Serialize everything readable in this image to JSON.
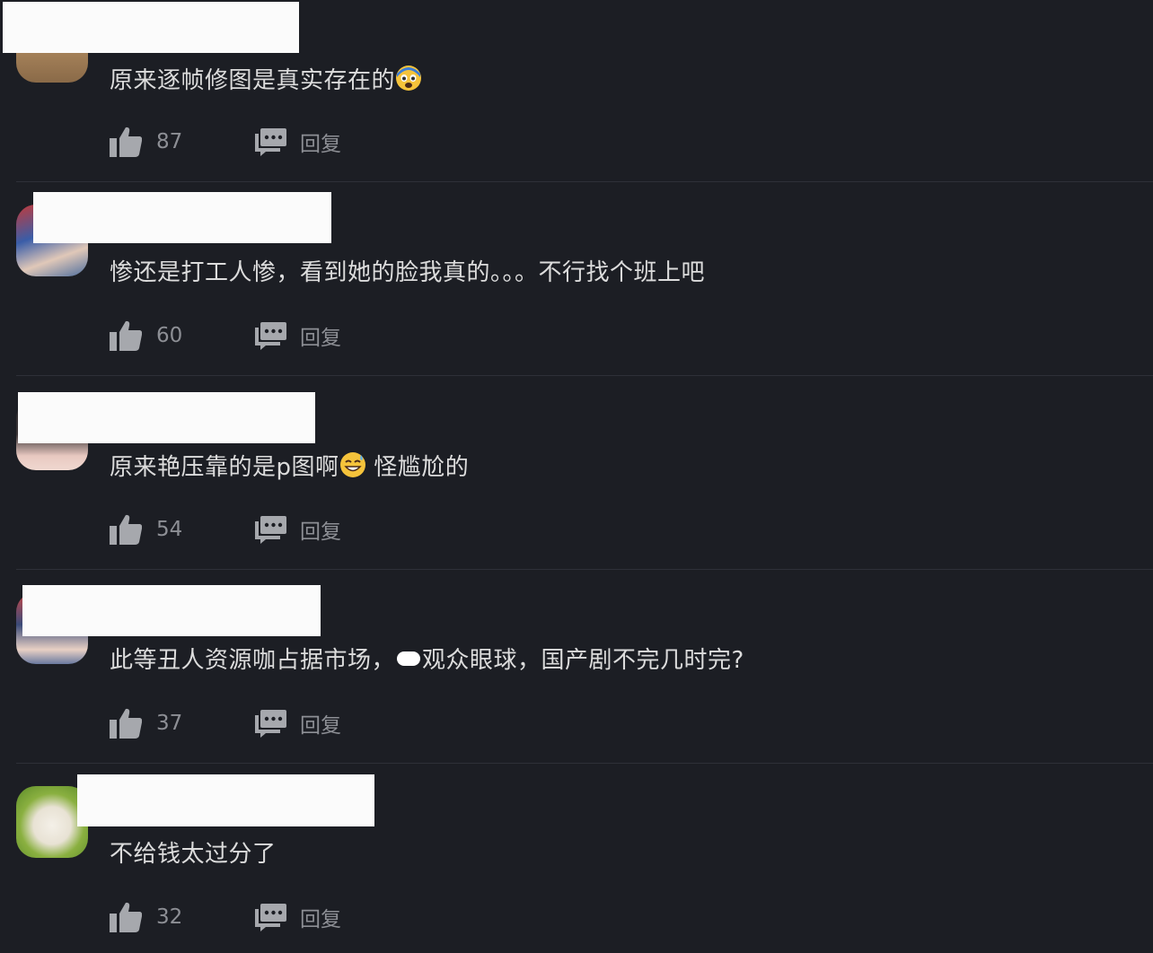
{
  "comments": [
    {
      "text": "原来逐帧修图是真实存在的",
      "emoji": "fearful-face",
      "likes": "87",
      "reply_label": "回复"
    },
    {
      "text": "惨还是打工人惨，看到她的脸我真的。。。不行找个班上吧",
      "likes": "60",
      "reply_label": "回复"
    },
    {
      "text_before_emoji": "原来艳压靠的是p图啊",
      "emoji": "grinning-sweat-face",
      "text_after_emoji": "怪尴尬的",
      "likes": "54",
      "reply_label": "回复"
    },
    {
      "text_before_mask": "此等丑人资源咖占据市场，",
      "text_after_mask": "观众眼球，国产剧不完几时完?",
      "likes": "37",
      "reply_label": "回复"
    },
    {
      "text": "不给钱太过分了",
      "likes": "32",
      "reply_label": "回复"
    }
  ],
  "colors": {
    "background": "#1c1e24",
    "text": "#dcdcdc",
    "meta": "#8d8f95",
    "name_redaction": "#fbfbfb"
  }
}
